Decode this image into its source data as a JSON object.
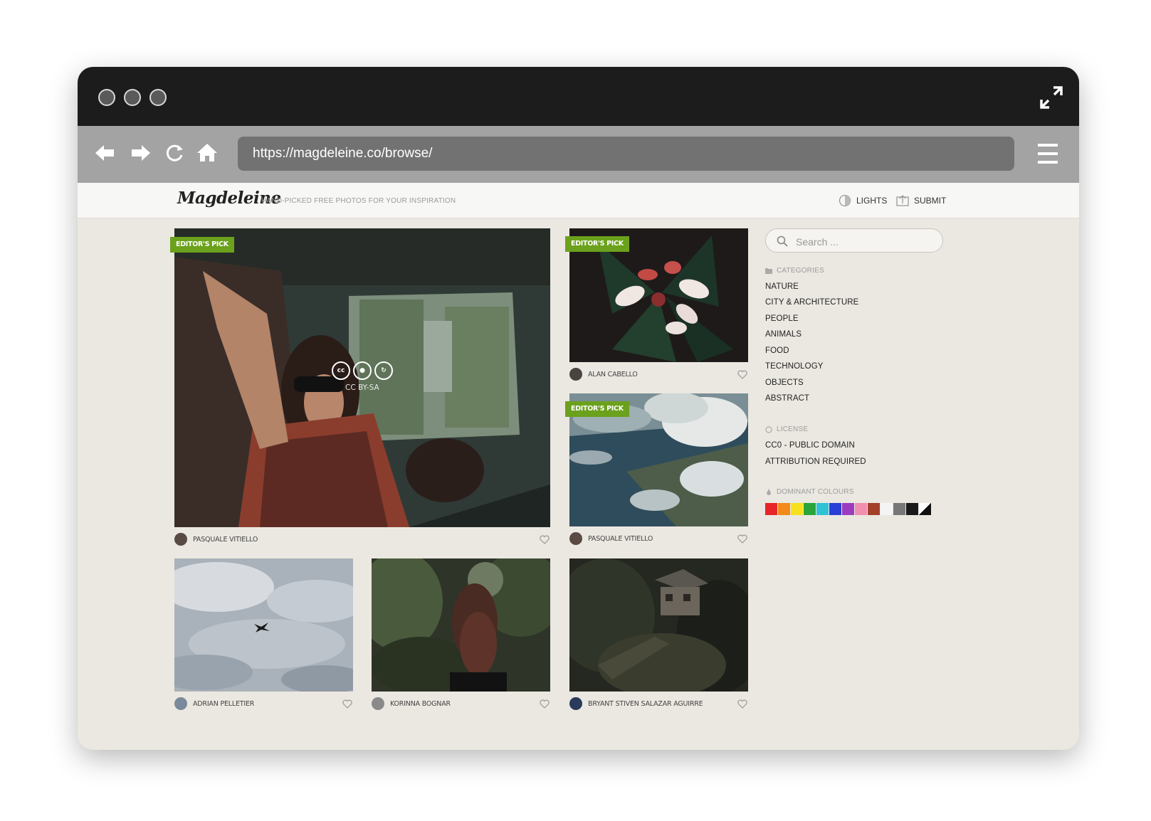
{
  "browser": {
    "url": "https://magdeleine.co/browse/"
  },
  "site": {
    "logo": "Magdeleine",
    "tagline": "HAND-PICKED FREE PHOTOS FOR YOUR INSPIRATION",
    "lights_label": "LIGHTS",
    "submit_label": "SUBMIT"
  },
  "photos": [
    {
      "author": "PASQUALE VITIELLO",
      "badge": "EDITOR'S PICK",
      "license": "CC BY-SA"
    },
    {
      "author": "ALAN CABELLO",
      "badge": "EDITOR'S PICK"
    },
    {
      "author": "PASQUALE VITIELLO",
      "badge": "EDITOR'S PICK"
    },
    {
      "author": "ADRIAN PELLETIER"
    },
    {
      "author": "KORINNA BOGNAR"
    },
    {
      "author": "BRYANT STIVEN SALAZAR AGUIRRE"
    }
  ],
  "sidebar": {
    "search_placeholder": "Search ...",
    "categories_title": "CATEGORIES",
    "categories": [
      "NATURE",
      "CITY & ARCHITECTURE",
      "PEOPLE",
      "ANIMALS",
      "FOOD",
      "TECHNOLOGY",
      "OBJECTS",
      "ABSTRACT"
    ],
    "license_title": "LICENSE",
    "licenses": [
      "CC0 - PUBLIC DOMAIN",
      "ATTRIBUTION REQUIRED"
    ],
    "colours_title": "DOMINANT COLOURS",
    "colours": [
      "#e8262a",
      "#f28a1a",
      "#f5e11d",
      "#2aa43b",
      "#2ec2d6",
      "#2a3fd6",
      "#9b3cc0",
      "#f08fb0",
      "#a3402a",
      "#f4f4f4",
      "#777777",
      "#1a1a1a",
      "bw"
    ]
  }
}
